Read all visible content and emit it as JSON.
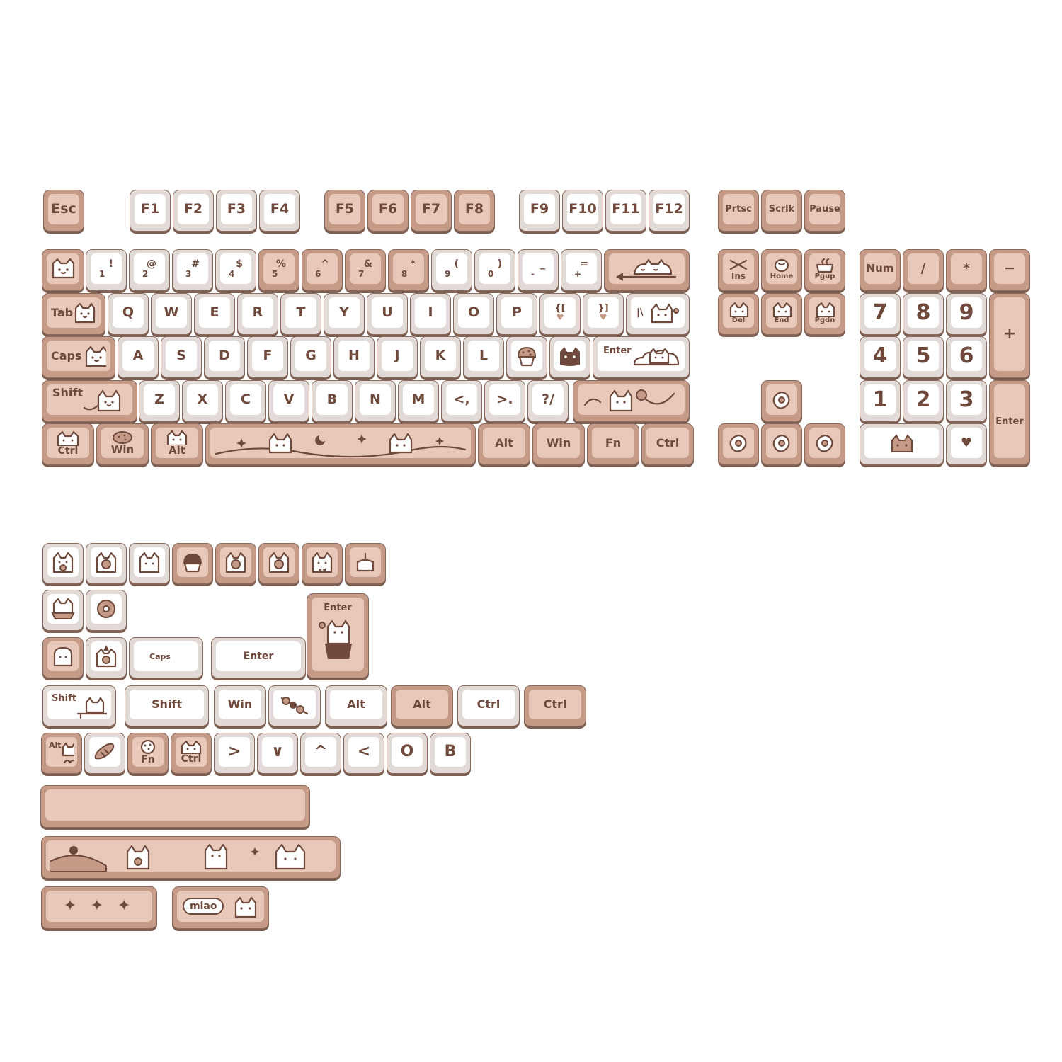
{
  "colors": {
    "tan": "#c59a87",
    "tan_top": "#e8c9b9",
    "white_top": "#ffffff",
    "ink": "#6f4a3c",
    "border": "#8a6a5c"
  },
  "fn_row": {
    "esc": "Esc",
    "f1": "F1",
    "f2": "F2",
    "f3": "F3",
    "f4": "F4",
    "f5": "F5",
    "f6": "F6",
    "f7": "F7",
    "f8": "F8",
    "f9": "F9",
    "f10": "F10",
    "f11": "F11",
    "f12": "F12",
    "prtsc": "Prtsc",
    "scrlk": "Scrlk",
    "pause": "Pause"
  },
  "num_row": [
    {
      "up": "!",
      "dn": "1"
    },
    {
      "up": "@",
      "dn": "2"
    },
    {
      "up": "#",
      "dn": "3"
    },
    {
      "up": "$",
      "dn": "4"
    },
    {
      "up": "%",
      "dn": "5"
    },
    {
      "up": "^",
      "dn": "6"
    },
    {
      "up": "&",
      "dn": "7"
    },
    {
      "up": "*",
      "dn": "8"
    },
    {
      "up": "(",
      "dn": "9"
    },
    {
      "up": ")",
      "dn": "0"
    },
    {
      "up": "_",
      "dn": "-"
    },
    {
      "up": "=",
      "dn": "+"
    }
  ],
  "q_row": {
    "tab": "Tab",
    "q": "Q",
    "w": "W",
    "e": "E",
    "r": "R",
    "t": "T",
    "y": "Y",
    "u": "U",
    "i": "I",
    "o": "O",
    "p": "P",
    "lbr": "{[",
    "rbr": "}]",
    "bsl": "|\\"
  },
  "a_row": {
    "caps": "Caps",
    "a": "A",
    "s": "S",
    "d": "D",
    "f": "F",
    "g": "G",
    "h": "H",
    "j": "J",
    "k": "K",
    "l": "L",
    "enter": "Enter"
  },
  "z_row": {
    "shift": "Shift",
    "z": "Z",
    "x": "X",
    "c": "C",
    "v": "V",
    "b": "B",
    "n": "N",
    "m": "M",
    "comma": "<,",
    "period": ">.",
    "slash": "?/"
  },
  "bottom_row": {
    "ctrl": "Ctrl",
    "win": "Win",
    "alt": "Alt",
    "ralt": "Alt",
    "rwin": "Win",
    "fn": "Fn",
    "rctrl": "Ctrl"
  },
  "nav": {
    "ins": "Ins",
    "home": "Home",
    "pgup": "Pgup",
    "del": "Del",
    "end": "End",
    "pgdn": "Pgdn"
  },
  "numpad": {
    "num": "Num",
    "slash": "/",
    "star": "*",
    "minus": "−",
    "plus": "+",
    "n7": "7",
    "n8": "8",
    "n9": "9",
    "n4": "4",
    "n5": "5",
    "n6": "6",
    "n1": "1",
    "n2": "2",
    "n3": "3",
    "enter": "Enter",
    "heart": "♥"
  },
  "extras": {
    "iso_enter": "Enter",
    "caps": "Caps",
    "enter": "Enter",
    "shift_a": "Shift",
    "shift_b": "Shift",
    "win": "Win",
    "alt_a": "Alt",
    "alt_b": "Alt",
    "ctrl_a": "Ctrl",
    "ctrl_b": "Ctrl",
    "alt_c": "Alt",
    "fn": "Fn",
    "ctrl_c": "Ctrl",
    "arrow_r": ">",
    "arrow_d": "∨",
    "arrow_u": "^",
    "arrow_l": "<",
    "o": "O",
    "b": "B",
    "sparkles": "✦ ✦ ✦",
    "miao": "miao"
  }
}
